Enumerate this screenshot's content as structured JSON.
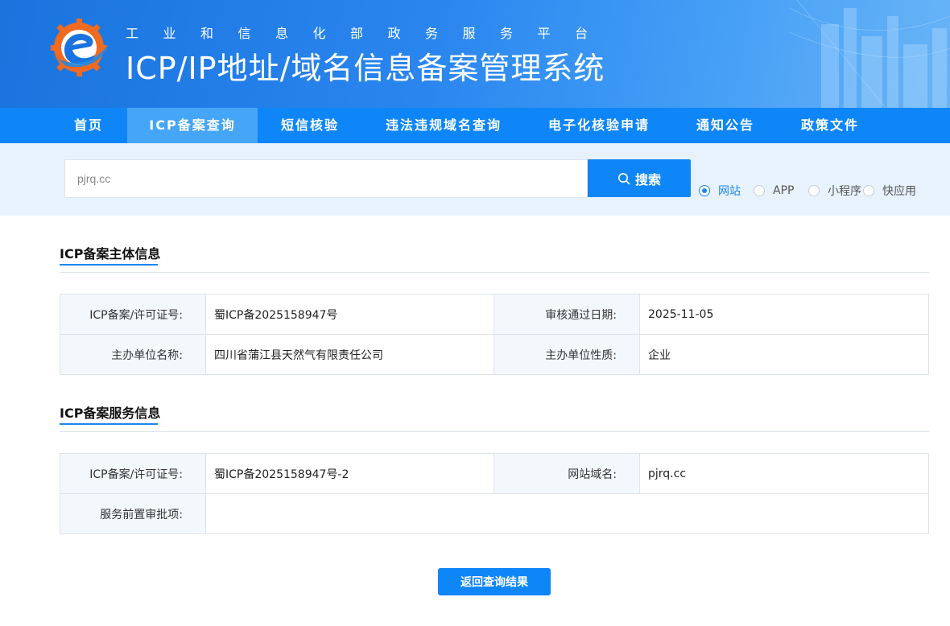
{
  "header": {
    "subtitle": "工业和信息化部政务服务平台",
    "title": "ICP/IP地址/域名信息备案管理系统"
  },
  "nav": {
    "items": [
      {
        "label": "首页",
        "active": false
      },
      {
        "label": "ICP备案查询",
        "active": true
      },
      {
        "label": "短信核验",
        "active": false
      },
      {
        "label": "违法违规域名查询",
        "active": false
      },
      {
        "label": "电子化核验申请",
        "active": false
      },
      {
        "label": "通知公告",
        "active": false
      },
      {
        "label": "政策文件",
        "active": false
      }
    ]
  },
  "search": {
    "value": "pjrq.cc",
    "button_label": "搜索",
    "types": [
      {
        "label": "网站",
        "checked": true
      },
      {
        "label": "APP",
        "checked": false
      },
      {
        "label": "小程序",
        "checked": false
      },
      {
        "label": "快应用",
        "checked": false
      }
    ]
  },
  "subject_info": {
    "title": "ICP备案主体信息",
    "rows": [
      {
        "label1": "ICP备案/许可证号:",
        "value1": "蜀ICP备2025158947号",
        "label2": "审核通过日期:",
        "value2": "2025-11-05"
      },
      {
        "label1": "主办单位名称:",
        "value1": "四川省蒲江县天然气有限责任公司",
        "label2": "主办单位性质:",
        "value2": "企业"
      }
    ]
  },
  "service_info": {
    "title": "ICP备案服务信息",
    "rows": [
      {
        "label1": "ICP备案/许可证号:",
        "value1": "蜀ICP备2025158947号-2",
        "label2": "网站域名:",
        "value2": "pjrq.cc"
      },
      {
        "label1": "服务前置审批项:",
        "value1": ""
      }
    ]
  },
  "back_button_label": "返回查询结果",
  "colors": {
    "primary": "#0f86f7",
    "nav_active": "#45a5f7",
    "search_band": "#e8f2fc",
    "label_bg": "#f3f8fd"
  }
}
